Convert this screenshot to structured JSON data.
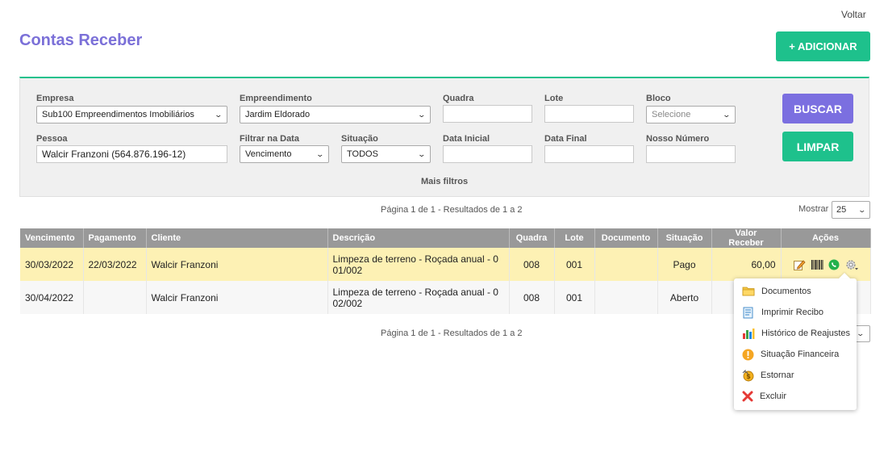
{
  "header": {
    "back_link": "Voltar",
    "title": "Contas Receber",
    "add_button": "+ ADICIONAR"
  },
  "filters": {
    "empresa": {
      "label": "Empresa",
      "value": "Sub100 Empreendimentos Imobiliários"
    },
    "empreendimento": {
      "label": "Empreendimento",
      "value": "Jardim Eldorado"
    },
    "quadra": {
      "label": "Quadra",
      "value": ""
    },
    "lote": {
      "label": "Lote",
      "value": ""
    },
    "bloco": {
      "label": "Bloco",
      "placeholder": "Selecione"
    },
    "pessoa": {
      "label": "Pessoa",
      "value": "Walcir Franzoni (564.876.196-12)"
    },
    "filtrar_data": {
      "label": "Filtrar na Data",
      "value": "Vencimento"
    },
    "situacao": {
      "label": "Situação",
      "value": "TODOS"
    },
    "data_inicial": {
      "label": "Data Inicial",
      "value": ""
    },
    "data_final": {
      "label": "Data Final",
      "value": ""
    },
    "nosso_numero": {
      "label": "Nosso Número",
      "value": ""
    },
    "mais_filtros": "Mais filtros",
    "buscar": "BUSCAR",
    "limpar": "LIMPAR"
  },
  "pagination": {
    "text_top": "Página 1 de 1 - Resultados de 1 a 2",
    "text_bottom": "Página 1 de 1 - Resultados de 1 a 2",
    "mostrar_label": "Mostrar",
    "mostrar_value": "25"
  },
  "table": {
    "columns": [
      "Vencimento",
      "Pagamento",
      "Cliente",
      "Descrição",
      "Quadra",
      "Lote",
      "Documento",
      "Situação",
      "Valor Receber",
      "Ações"
    ],
    "rows": [
      {
        "vencimento": "30/03/2022",
        "pagamento": "22/03/2022",
        "cliente": "Walcir Franzoni",
        "descricao_1": "Limpeza de terreno - Roçada anual - 0",
        "descricao_2": "01/002",
        "quadra": "008",
        "lote": "001",
        "documento": "",
        "situacao": "Pago",
        "valor": "60,00"
      },
      {
        "vencimento": "30/04/2022",
        "pagamento": "",
        "cliente": "Walcir Franzoni",
        "descricao_1": "Limpeza de terreno - Roçada anual - 0",
        "descricao_2": "02/002",
        "quadra": "008",
        "lote": "001",
        "documento": "",
        "situacao": "Aberto",
        "valor": ""
      }
    ]
  },
  "actions_menu": {
    "items": [
      {
        "label": "Documentos",
        "icon": "folder-icon"
      },
      {
        "label": "Imprimir Recibo",
        "icon": "receipt-icon"
      },
      {
        "label": "Histórico de Reajustes",
        "icon": "bar-chart-icon"
      },
      {
        "label": "Situação Financeira",
        "icon": "warning-icon"
      },
      {
        "label": "Estornar",
        "icon": "refund-coin-icon"
      },
      {
        "label": "Excluir",
        "icon": "delete-x-icon"
      }
    ]
  },
  "colors": {
    "brand_purple": "#7b70d8",
    "brand_green": "#1ec18c",
    "row_paid": "#fdf1b4",
    "header_gray": "#999999"
  }
}
